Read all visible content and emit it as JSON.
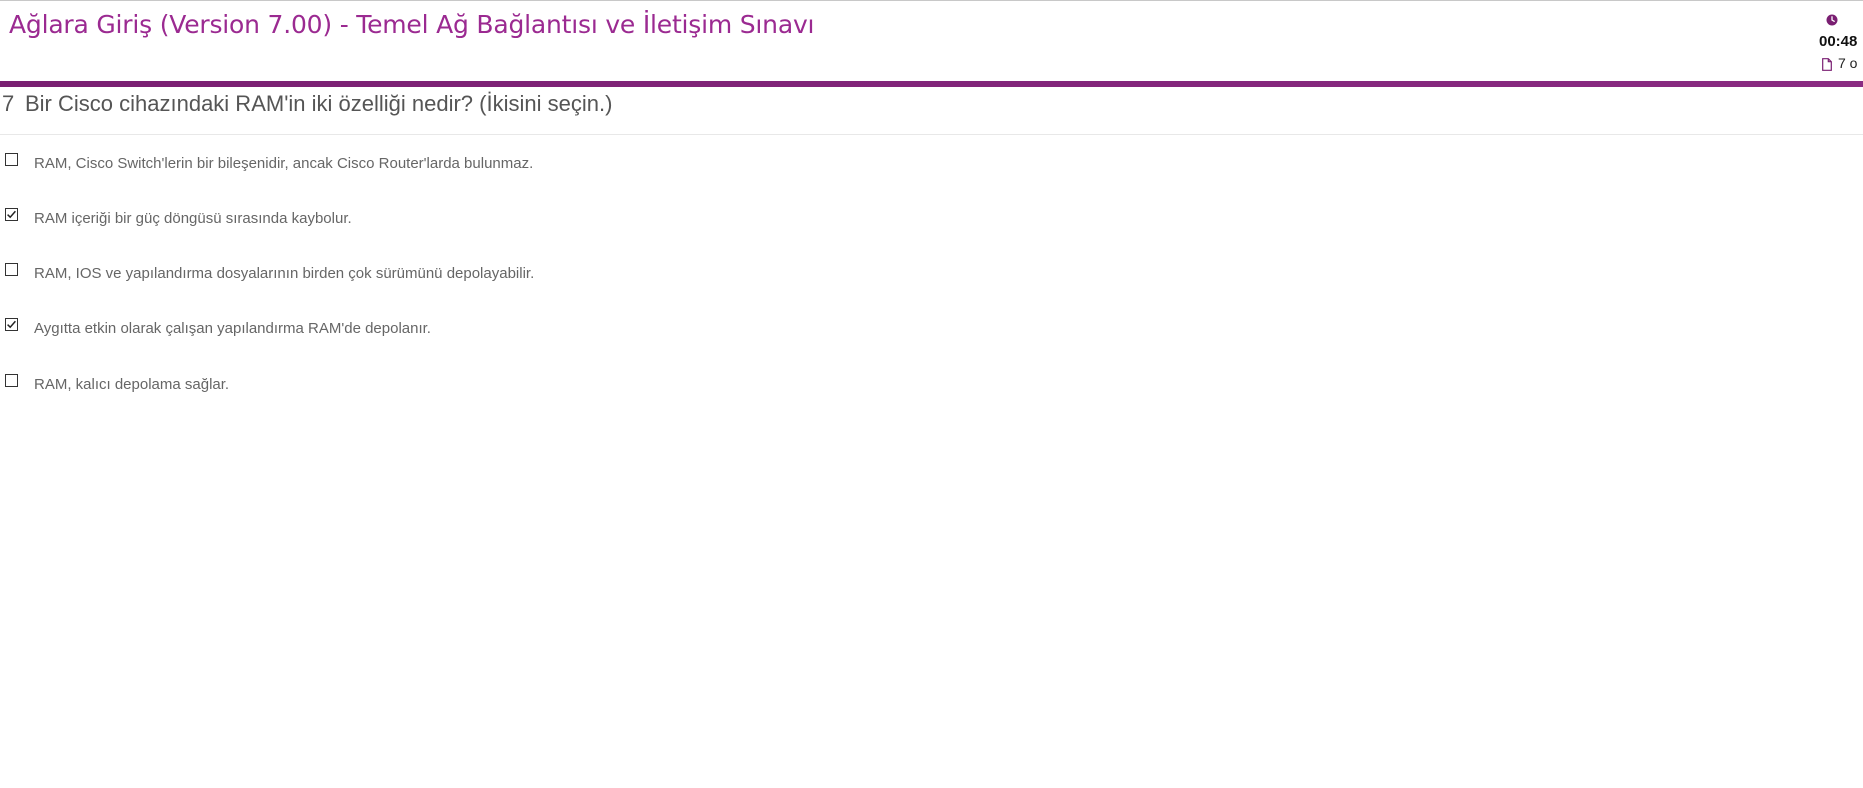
{
  "header": {
    "title": "Ağlara Giriş (Version 7.00) - Temel Ağ Bağlantısı ve İletişim Sınavı",
    "timer": "00:48",
    "page_count": "7 o",
    "icons": {
      "timer": "clock-icon",
      "page": "page-icon"
    }
  },
  "colors": {
    "brand": "#9b2a91",
    "bar": "#7a1f72"
  },
  "question": {
    "number": "7",
    "text": "Bir Cisco cihazındaki RAM'in iki özelliği nedir? (İkisini seçin.)",
    "options": [
      {
        "label": "RAM, Cisco Switch'lerin bir bileşenidir, ancak Cisco Router'larda bulunmaz.",
        "checked": false
      },
      {
        "label": "RAM içeriği bir güç döngüsü sırasında kaybolur.",
        "checked": true
      },
      {
        "label": "RAM, IOS ve yapılandırma dosyalarının birden çok sürümünü depolayabilir.",
        "checked": false
      },
      {
        "label": "Aygıtta etkin olarak çalışan yapılandırma RAM'de depolanır.",
        "checked": true
      },
      {
        "label": "RAM, kalıcı depolama sağlar.",
        "checked": false
      }
    ]
  }
}
